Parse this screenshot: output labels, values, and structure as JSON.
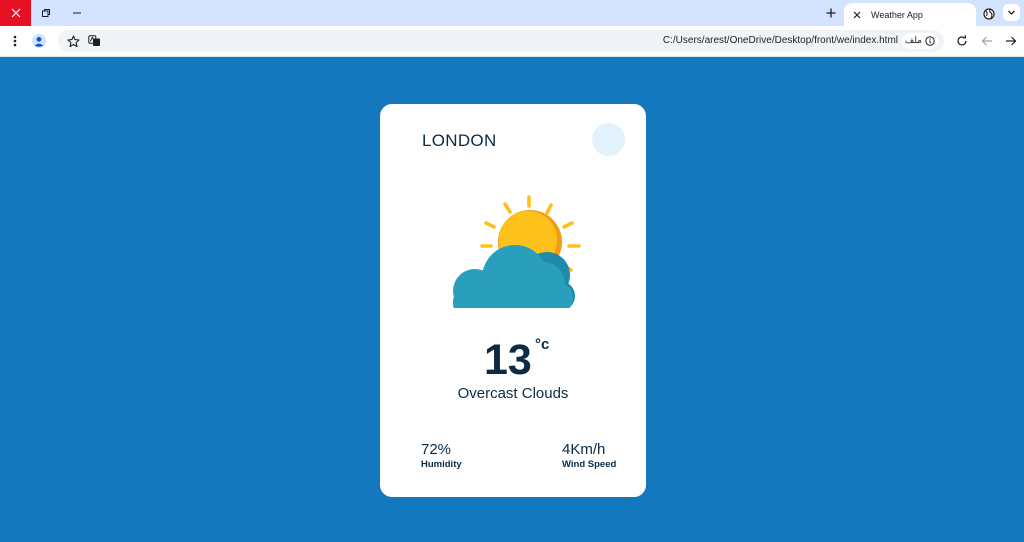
{
  "browser": {
    "tab_title": "Weather App",
    "url": "C:/Users/arest/OneDrive/Desktop/front/we/index.html",
    "file_chip_label": "ملف"
  },
  "weather": {
    "city": "LONDON",
    "temperature": "13",
    "unit": "°c",
    "description": "Overcast Clouds",
    "humidity_value": "72%",
    "humidity_label": "Humidity",
    "wind_value": "4Km/h",
    "wind_label": "Wind Speed",
    "icon": "partly-cloudy-icon"
  },
  "colors": {
    "page_background": "#1478be",
    "card_background": "#ffffff",
    "text": "#0b2b45",
    "sun": "#fcc21b",
    "cloud": "#2a9fbc"
  }
}
